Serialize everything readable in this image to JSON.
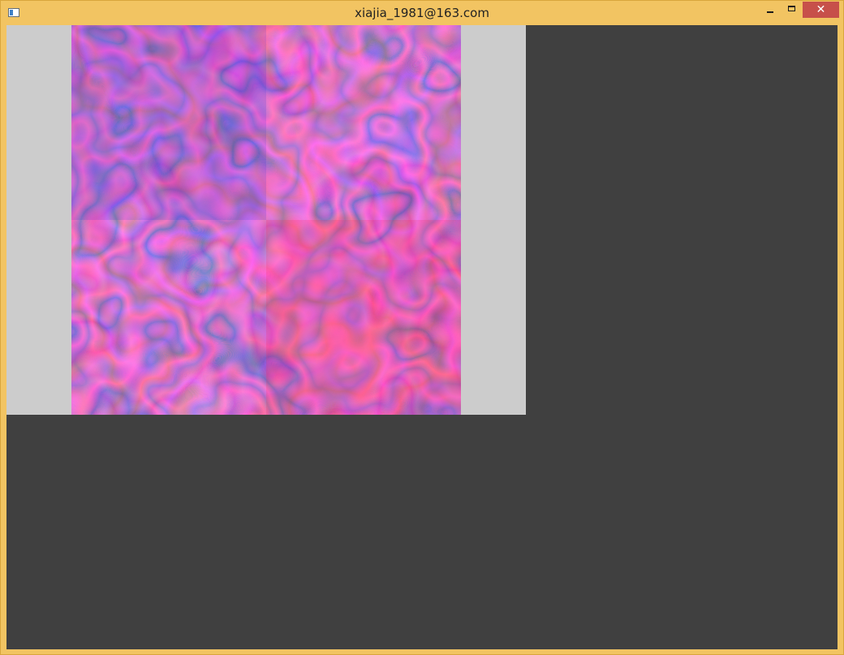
{
  "window": {
    "title": "xiajia_1981@163.com",
    "close_glyph": "✕"
  },
  "icons": {
    "app": "app-window-icon",
    "minimize": "minimize-icon",
    "maximize": "maximize-icon",
    "close": "close-icon"
  },
  "colors": {
    "frame": "#f2c462",
    "client_background": "#404040",
    "viewport_background": "#cccccc",
    "close_button": "#c7504a",
    "pattern_blue": "#2a1fc8",
    "pattern_magenta": "#e0308a",
    "pattern_red": "#ff2a50"
  }
}
